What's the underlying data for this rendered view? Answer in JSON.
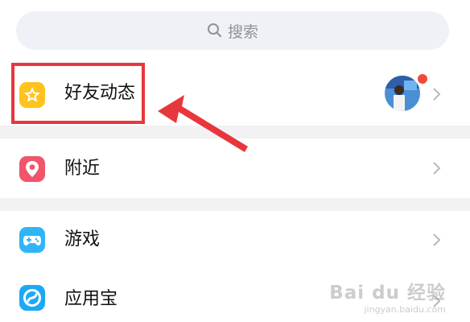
{
  "search": {
    "placeholder": "搜索",
    "icon": "search-icon"
  },
  "items": [
    {
      "label": "好友动态",
      "icon": "star-icon",
      "icon_color": "#ffc21e"
    },
    {
      "label": "附近",
      "icon": "location-pin-icon",
      "icon_color": "#f0556a"
    },
    {
      "label": "游戏",
      "icon": "gamepad-icon",
      "icon_color": "#2fb5f6"
    },
    {
      "label": "应用宝",
      "icon": "app-store-icon",
      "icon_color": "#1da8f5"
    }
  ],
  "annotation": {
    "box_color": "#e8373c",
    "arrow_color": "#e8373c"
  },
  "watermark": {
    "main": "Bai du 经验",
    "sub": "jingyan.baidu.com"
  }
}
